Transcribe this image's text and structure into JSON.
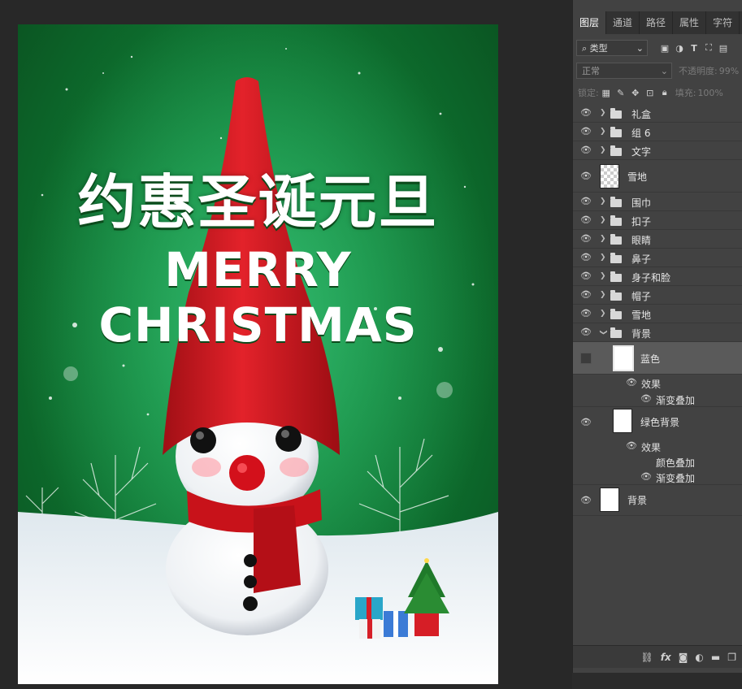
{
  "poster": {
    "title_cn": "约惠圣诞元旦",
    "title_en": "MERRY CHRISTMAS"
  },
  "panel": {
    "tabs": [
      "图层",
      "通道",
      "路径",
      "属性",
      "字符"
    ],
    "filter_kind": "类型",
    "blend_mode": "正常",
    "opacity_label": "不透明度:",
    "opacity_value": "99%",
    "lock_label": "锁定:",
    "fill_label": "填充:",
    "fill_value": "100%"
  },
  "layers": {
    "gift_box": "礼盒",
    "group6": "组 6",
    "text": "文字",
    "snow_ground_top": "雪地",
    "scarf": "围巾",
    "buttons": "扣子",
    "eyes": "眼睛",
    "nose": "鼻子",
    "body_face": "身子和脸",
    "hat": "帽子",
    "snow_ground": "雪地",
    "bg_group": "背景",
    "blue": "蓝色",
    "effects1": "效果",
    "gradient_overlay1": "渐变叠加",
    "green_bg": "绿色背景",
    "effects2": "效果",
    "color_overlay": "颜色叠加",
    "gradient_overlay2": "渐变叠加",
    "background": "背景"
  },
  "icons": {
    "eye": "eye-icon",
    "folder": "folder-icon",
    "link": "link-icon",
    "fx": "fx-icon",
    "mask": "mask-icon",
    "adjust": "adjustment-icon",
    "new_group": "new-group-icon",
    "new_layer": "new-layer-icon"
  },
  "colors": {
    "poster_green": "#14863f",
    "hat_red": "#c9161e",
    "panel_bg": "#424242"
  }
}
